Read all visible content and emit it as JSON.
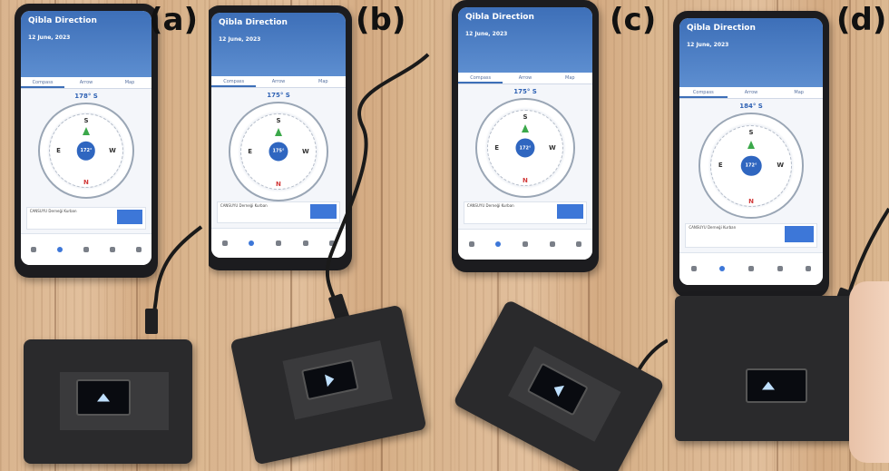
{
  "figure": {
    "panels": [
      {
        "label": "(a)",
        "degree": "178° S",
        "hub": "172°"
      },
      {
        "label": "(b)",
        "degree": "175° S",
        "hub": "175°"
      },
      {
        "label": "(c)",
        "degree": "175° S",
        "hub": "172°"
      },
      {
        "label": "(d)",
        "degree": "184° S",
        "hub": "172°"
      }
    ],
    "app": {
      "title": "Qibla Direction",
      "date": "12 June, 2023",
      "tabs": [
        "Compass",
        "Arrow",
        "Map"
      ],
      "cardinals": {
        "n": "N",
        "s": "S",
        "e": "E",
        "w": "W"
      },
      "ad_text": "CANSUYU Derneği Kurban",
      "ad_button": "Aç"
    },
    "colors": {
      "app_blue": "#3d6fb8",
      "qibla_needle": "#3ba84a",
      "device_body": "#2a2a2c"
    }
  }
}
